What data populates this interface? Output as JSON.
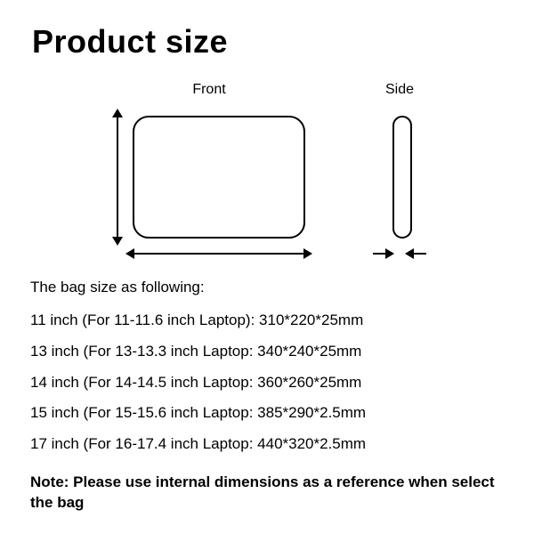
{
  "title": "Product size",
  "views": {
    "front": "Front",
    "side": "Side"
  },
  "lead": "The bag size as following:",
  "sizes": [
    "11 inch (For 11-11.6 inch Laptop): 310*220*25mm",
    "13 inch (For 13-13.3 inch Laptop: 340*240*25mm",
    "14 inch (For 14-14.5 inch Laptop: 360*260*25mm",
    "15 inch (For 15-15.6 inch Laptop: 385*290*2.5mm",
    "17 inch (For 16-17.4 inch Laptop: 440*320*2.5mm"
  ],
  "note": "Note: Please use internal dimensions as a reference when select the bag"
}
